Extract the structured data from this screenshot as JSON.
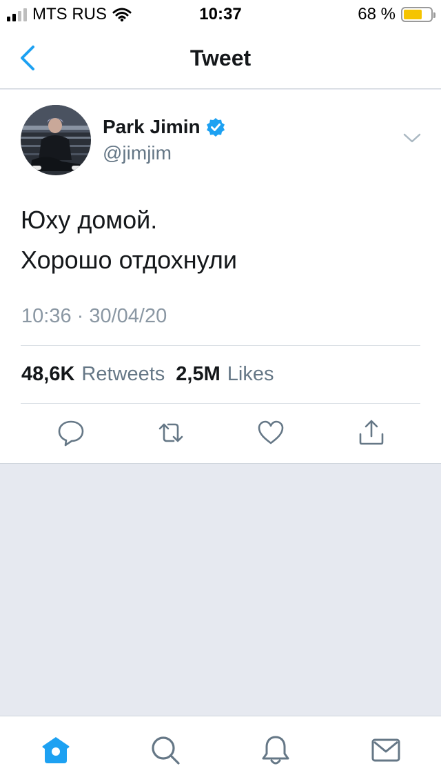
{
  "status_bar": {
    "carrier": "MTS RUS",
    "time": "10:37",
    "battery_percent_text": "68 %",
    "battery_level": 0.68,
    "battery_color": "#f5c400"
  },
  "nav": {
    "back_icon": "chevron-left-icon",
    "title": "Tweet"
  },
  "tweet": {
    "author_name": "Park Jimin",
    "verified": true,
    "handle": "@jimjim",
    "text_lines": [
      "Юху домой.",
      "Хорошо отдохнули"
    ],
    "timestamp": "10:36 · 30/04/20",
    "retweets_count": "48,6K",
    "retweets_label": "Retweets",
    "likes_count": "2,5M",
    "likes_label": "Likes"
  },
  "actions": [
    "reply-icon",
    "retweet-icon",
    "like-icon",
    "share-icon"
  ],
  "tabs": [
    {
      "icon": "home-icon",
      "active": true
    },
    {
      "icon": "search-icon",
      "active": false
    },
    {
      "icon": "bell-icon",
      "active": false
    },
    {
      "icon": "mail-icon",
      "active": false
    }
  ],
  "colors": {
    "accent": "#1da1f2",
    "icon_gray": "#657786",
    "background": "#e6e9f0"
  }
}
